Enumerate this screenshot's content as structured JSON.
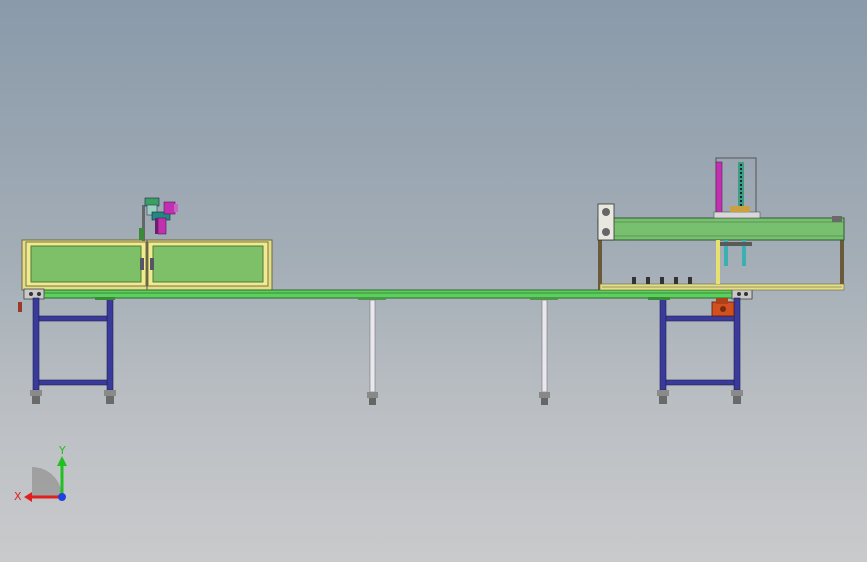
{
  "viewport": {
    "background_top": "#8a9aaa",
    "background_bottom": "#c9cacc"
  },
  "model": {
    "description_icon": "conveyor-machine-model",
    "colors": {
      "bed_green": "#7dc068",
      "bed_frame": "#e6e08a",
      "rail_green": "#5cd05c",
      "legs_blue": "#3a3a9a",
      "legs_white": "#e8e8ee",
      "hood_green": "#78c070",
      "press_magenta": "#c030b0",
      "bracket_orange": "#d05020"
    }
  },
  "triad": {
    "x_label": "X",
    "y_label": "Y",
    "x_color": "#e02020",
    "y_color": "#20c020",
    "z_color": "#2040e0"
  }
}
